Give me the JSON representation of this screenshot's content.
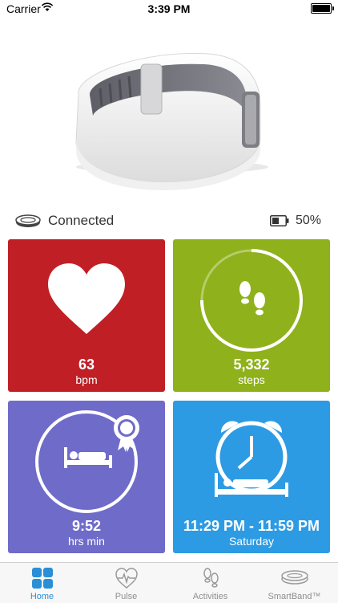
{
  "status_bar": {
    "carrier": "Carrier",
    "time": "3:39 PM",
    "battery_level": 1.0
  },
  "device": {
    "connection": "Connected",
    "battery": "50%",
    "battery_level": 0.5
  },
  "tiles": {
    "pulse": {
      "value": "63",
      "unit": "bpm",
      "color": "#c01f26",
      "icon": "heart-icon"
    },
    "steps": {
      "value": "5,332",
      "unit": "steps",
      "color": "#8fb11b",
      "icon": "footprints-icon",
      "progress": 0.75
    },
    "sleep": {
      "value": "9:52",
      "unit": "hrs min",
      "color": "#6f6bc9",
      "icon": "bed-icon",
      "badge": "award-ribbon-icon"
    },
    "alarm": {
      "value": "11:29 PM - 11:59 PM",
      "unit": "Saturday",
      "color": "#2d9be3",
      "icon": "alarm-clock-icon"
    }
  },
  "tabbar": {
    "active_color": "#2a8fd6",
    "tabs": [
      {
        "label": "Home",
        "icon": "grid-icon",
        "active": true
      },
      {
        "label": "Pulse",
        "icon": "pulse-heart-icon",
        "active": false
      },
      {
        "label": "Activities",
        "icon": "footprints-icon",
        "active": false
      },
      {
        "label": "SmartBand™",
        "icon": "smartband-icon",
        "active": false
      }
    ]
  }
}
